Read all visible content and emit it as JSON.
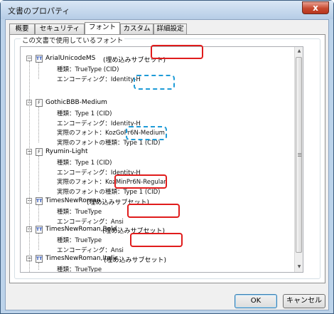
{
  "window": {
    "title": "文書のプロパティ",
    "close_glyph": "x"
  },
  "tabs": [
    {
      "label": "概要"
    },
    {
      "label": "セキュリティ"
    },
    {
      "label": "フォント"
    },
    {
      "label": "カスタム"
    },
    {
      "label": "詳細設定"
    }
  ],
  "active_tab": "フォント",
  "group_label": "この文書で使用しているフォント",
  "fonts": [
    {
      "name": "ArialUnicodeMS",
      "icon": "TT",
      "tag": "(埋め込みサブセット)",
      "props": [
        "種類：TrueType (CID)",
        "エンコーディング：Identity-H"
      ]
    },
    {
      "name": "GothicBBB-Medium",
      "icon": "F",
      "props": [
        "種類：Type 1 (CID)",
        "エンコーディング：Identity-H",
        "実際のフォント：KozGoPr6N-Medium",
        "実際のフォントの種類：Type 1 (CID)"
      ]
    },
    {
      "name": "Ryumin-Light",
      "icon": "F",
      "props": [
        "種類：Type 1 (CID)",
        "エンコーディング：Identity-H",
        "実際のフォント：KozMinPr6N-Regular",
        "実際のフォントの種類：Type 1 (CID)"
      ]
    },
    {
      "name": "TimesNewRoman",
      "icon": "TT",
      "tag": "(埋め込みサブセット)",
      "props": [
        "種類：TrueType",
        "エンコーディング：Ansi"
      ]
    },
    {
      "name": "TimesNewRoman,Bold",
      "icon": "TT",
      "tag": "(埋め込みサブセット)",
      "props": [
        "種類：TrueType",
        "エンコーディング：Ansi"
      ]
    },
    {
      "name": "TimesNewRoman,Italic",
      "icon": "TT",
      "tag": "(埋め込みサブセット)",
      "props": [
        "種類：TrueType"
      ]
    }
  ],
  "buttons": {
    "ok": "OK",
    "cancel": "キャンセル"
  },
  "colors": {
    "highlight_red": "#e01c1c",
    "highlight_blue": "#1e9bd7",
    "title_bar": "#c6d9ee"
  }
}
